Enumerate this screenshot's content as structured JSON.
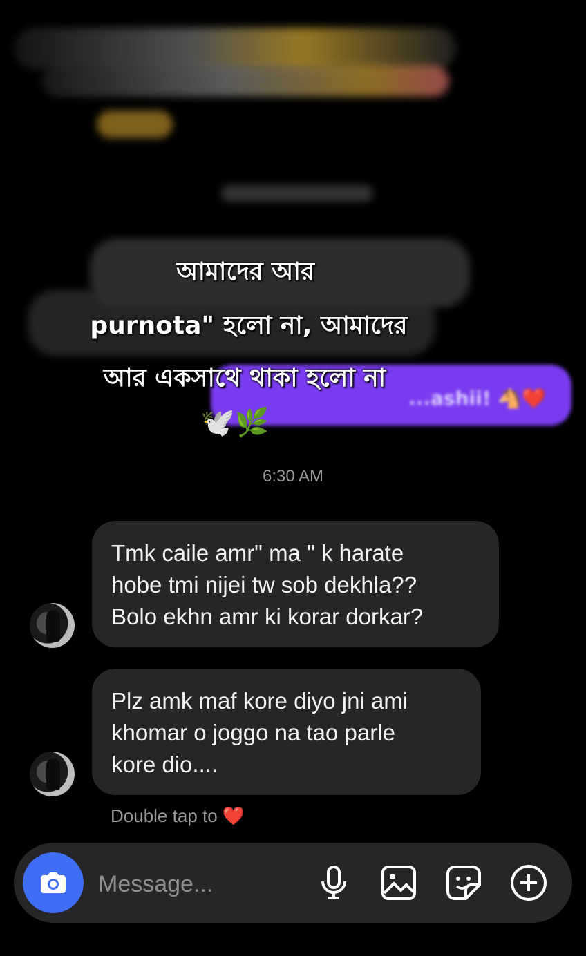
{
  "overlay": {
    "line1": "আমাদের আর",
    "line2": "purnota\" হলো না, আমাদের",
    "line3": "আর একসাথে থাকা হলো না",
    "emojis": "🕊️🌿"
  },
  "reply_preview": {
    "text": "...ashii! 🐴❤️"
  },
  "timestamp": "6:30 AM",
  "messages": [
    {
      "lines": [
        "Tmk caile amr\" ma \" k harate",
        "hobe tmi nijei tw sob dekhla??",
        "Bolo ekhn amr ki korar dorkar?"
      ]
    },
    {
      "lines": [
        "Plz amk maf kore diyo jni ami",
        "khomar o joggo na tao parle",
        "kore dio...."
      ]
    }
  ],
  "hint": {
    "text": "Double tap to",
    "emoji": "❤️"
  },
  "composer": {
    "placeholder": "Message..."
  },
  "icons": [
    "camera-icon",
    "microphone-icon",
    "gallery-icon",
    "sticker-icon",
    "add-icon"
  ],
  "colors": {
    "camera_button": "#3f6ef5",
    "bubble": "#262628",
    "reply_strip": "#7a3cf0"
  }
}
